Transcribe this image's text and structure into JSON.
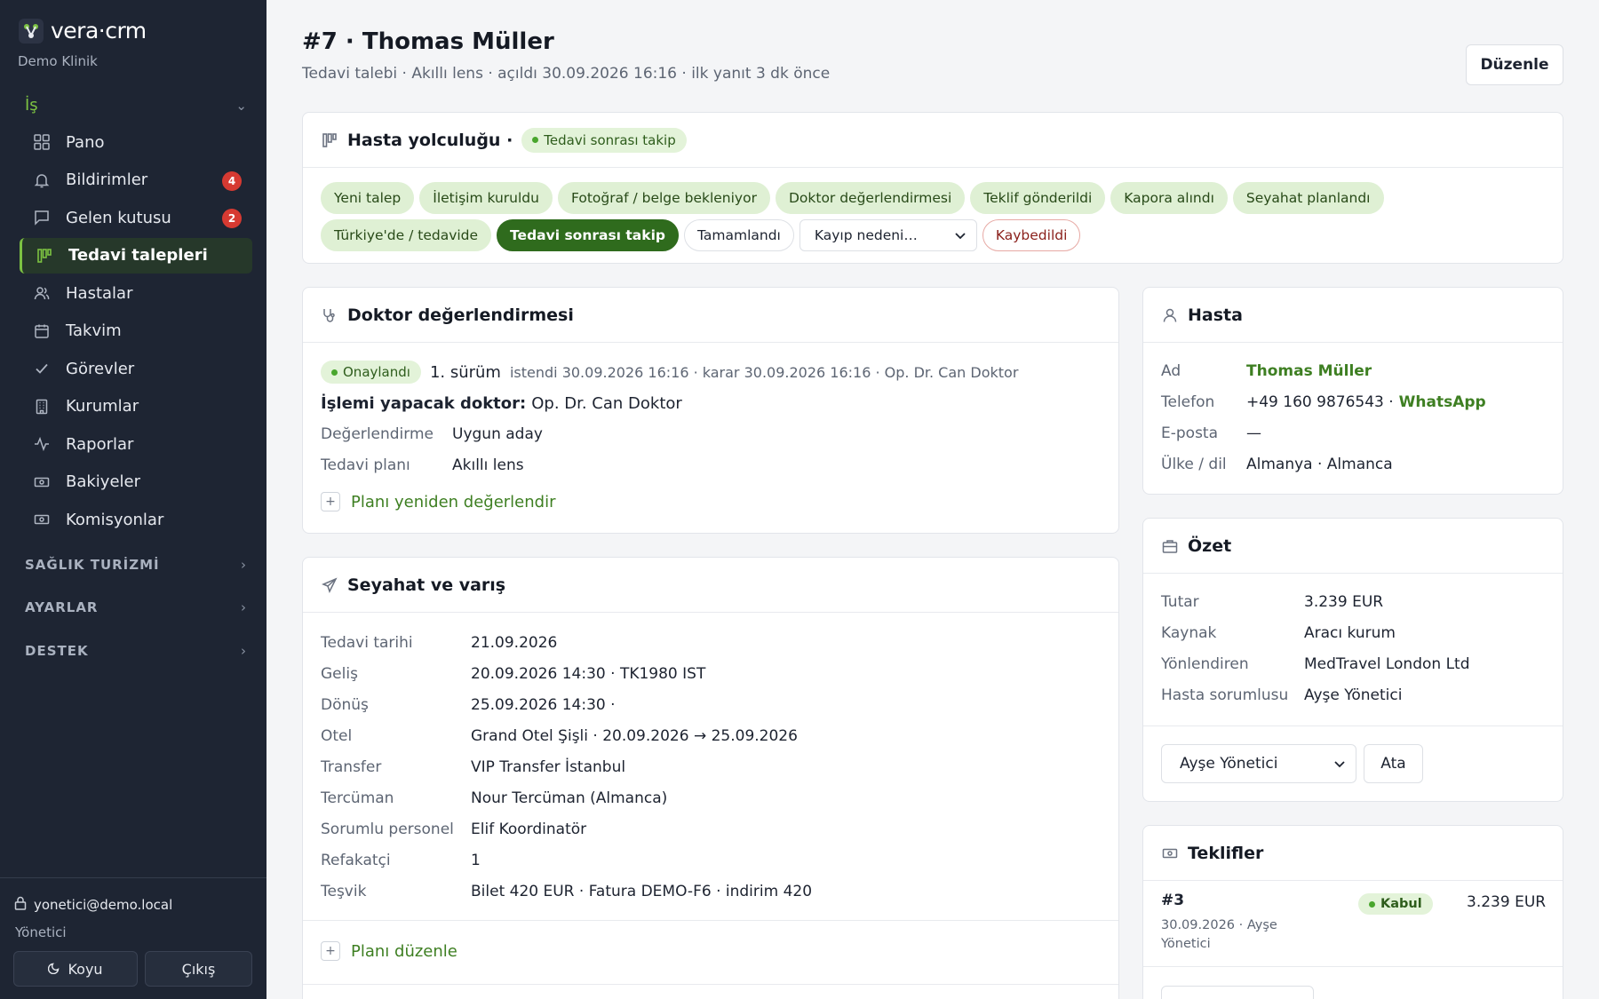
{
  "sidebar": {
    "brand": "vera·crm",
    "brand_sub": "Demo Klinik",
    "group_active": "İş",
    "items": [
      {
        "label": "Pano",
        "icon": "grid-icon"
      },
      {
        "label": "Bildirimler",
        "icon": "bell-icon",
        "badge": "4"
      },
      {
        "label": "Gelen kutusu",
        "icon": "message-icon",
        "badge": "2"
      },
      {
        "label": "Tedavi talepleri",
        "icon": "kanban-icon",
        "active": true
      },
      {
        "label": "Hastalar",
        "icon": "users-icon"
      },
      {
        "label": "Takvim",
        "icon": "calendar-icon"
      },
      {
        "label": "Görevler",
        "icon": "check-icon"
      },
      {
        "label": "Kurumlar",
        "icon": "building-icon"
      },
      {
        "label": "Raporlar",
        "icon": "activity-icon"
      },
      {
        "label": "Bakiyeler",
        "icon": "banknote-icon"
      },
      {
        "label": "Komisyonlar",
        "icon": "banknote-icon"
      }
    ],
    "groups": [
      "SAĞLIK TURİZMİ",
      "AYARLAR",
      "DESTEK"
    ],
    "user_email": "yonetici@demo.local",
    "user_role": "Yönetici",
    "theme_btn": "Koyu",
    "logout_btn": "Çıkış"
  },
  "header": {
    "title": "#7 · Thomas Müller",
    "subtitle": "Tedavi talebi · Akıllı lens · açıldı 30.09.2026 16:16 · ilk yanıt 3 dk önce",
    "edit_btn": "Düzenle"
  },
  "journey": {
    "title": "Hasta yolculuğu ·",
    "status": "Tedavi sonrası takip",
    "stages": [
      "Yeni talep",
      "İletişim kuruldu",
      "Fotoğraf / belge bekleniyor",
      "Doktor değerlendirmesi",
      "Teklif gönderildi",
      "Kapora alındı",
      "Seyahat planlandı",
      "Türkiye'de / tedavide"
    ],
    "current_stage": "Tedavi sonrası takip",
    "done_stage": "Tamamlandı",
    "loss_select": "Kayıp nedeni…",
    "lost_stage": "Kaybedildi"
  },
  "doctor": {
    "title": "Doktor değerlendirmesi",
    "status": "Onaylandı",
    "version": "1. sürüm",
    "meta": "istendi 30.09.2026 16:16 · karar 30.09.2026 16:16 · Op. Dr. Can Doktor",
    "doctor_label": "İşlemi yapacak doktor:",
    "doctor_value": "Op. Dr. Can Doktor",
    "eval_label": "Değerlendirme",
    "eval_value": "Uygun aday",
    "plan_label": "Tedavi planı",
    "plan_value": "Akıllı lens",
    "reeval_link": "Planı yeniden değerlendir"
  },
  "travel": {
    "title": "Seyahat ve varış",
    "rows": [
      {
        "k": "Tedavi tarihi",
        "v": "21.09.2026"
      },
      {
        "k": "Geliş",
        "v": "20.09.2026 14:30 · TK1980 IST"
      },
      {
        "k": "Dönüş",
        "v": "25.09.2026 14:30 ·"
      },
      {
        "k": "Otel",
        "v": "Grand Otel Şişli · 20.09.2026 → 25.09.2026"
      },
      {
        "k": "Transfer",
        "v": "VIP Transfer İstanbul"
      },
      {
        "k": "Tercüman",
        "v": "Nour Tercüman (Almanca)"
      },
      {
        "k": "Sorumlu personel",
        "v": "Elif Koordinatör"
      },
      {
        "k": "Refakatçi",
        "v": "1"
      },
      {
        "k": "Teşvik",
        "v": "Bilet 420 EUR · Fatura DEMO-F6 · indirim 420"
      }
    ],
    "edit_link": "Planı düzenle"
  },
  "patient": {
    "title": "Hasta",
    "name_label": "Ad",
    "name_value": "Thomas Müller",
    "phone_label": "Telefon",
    "phone_value": "+49 160 9876543 ·",
    "phone_link": "WhatsApp",
    "email_label": "E-posta",
    "email_value": "—",
    "country_label": "Ülke / dil",
    "country_value": "Almanya · Almanca"
  },
  "summary": {
    "title": "Özet",
    "rows": [
      {
        "k": "Tutar",
        "v": "3.239 EUR"
      },
      {
        "k": "Kaynak",
        "v": "Aracı kurum"
      },
      {
        "k": "Yönlendiren",
        "v": "MedTravel London Ltd"
      },
      {
        "k": "Hasta sorumlusu",
        "v": "Ayşe Yönetici"
      }
    ],
    "assignee_select": "Ayşe Yönetici",
    "assign_btn": "Ata"
  },
  "offers": {
    "title": "Teklifler",
    "items": [
      {
        "id": "#3",
        "meta": "30.09.2026 · Ayşe Yönetici",
        "status": "Kabul",
        "amount": "3.239 EUR"
      }
    ]
  }
}
